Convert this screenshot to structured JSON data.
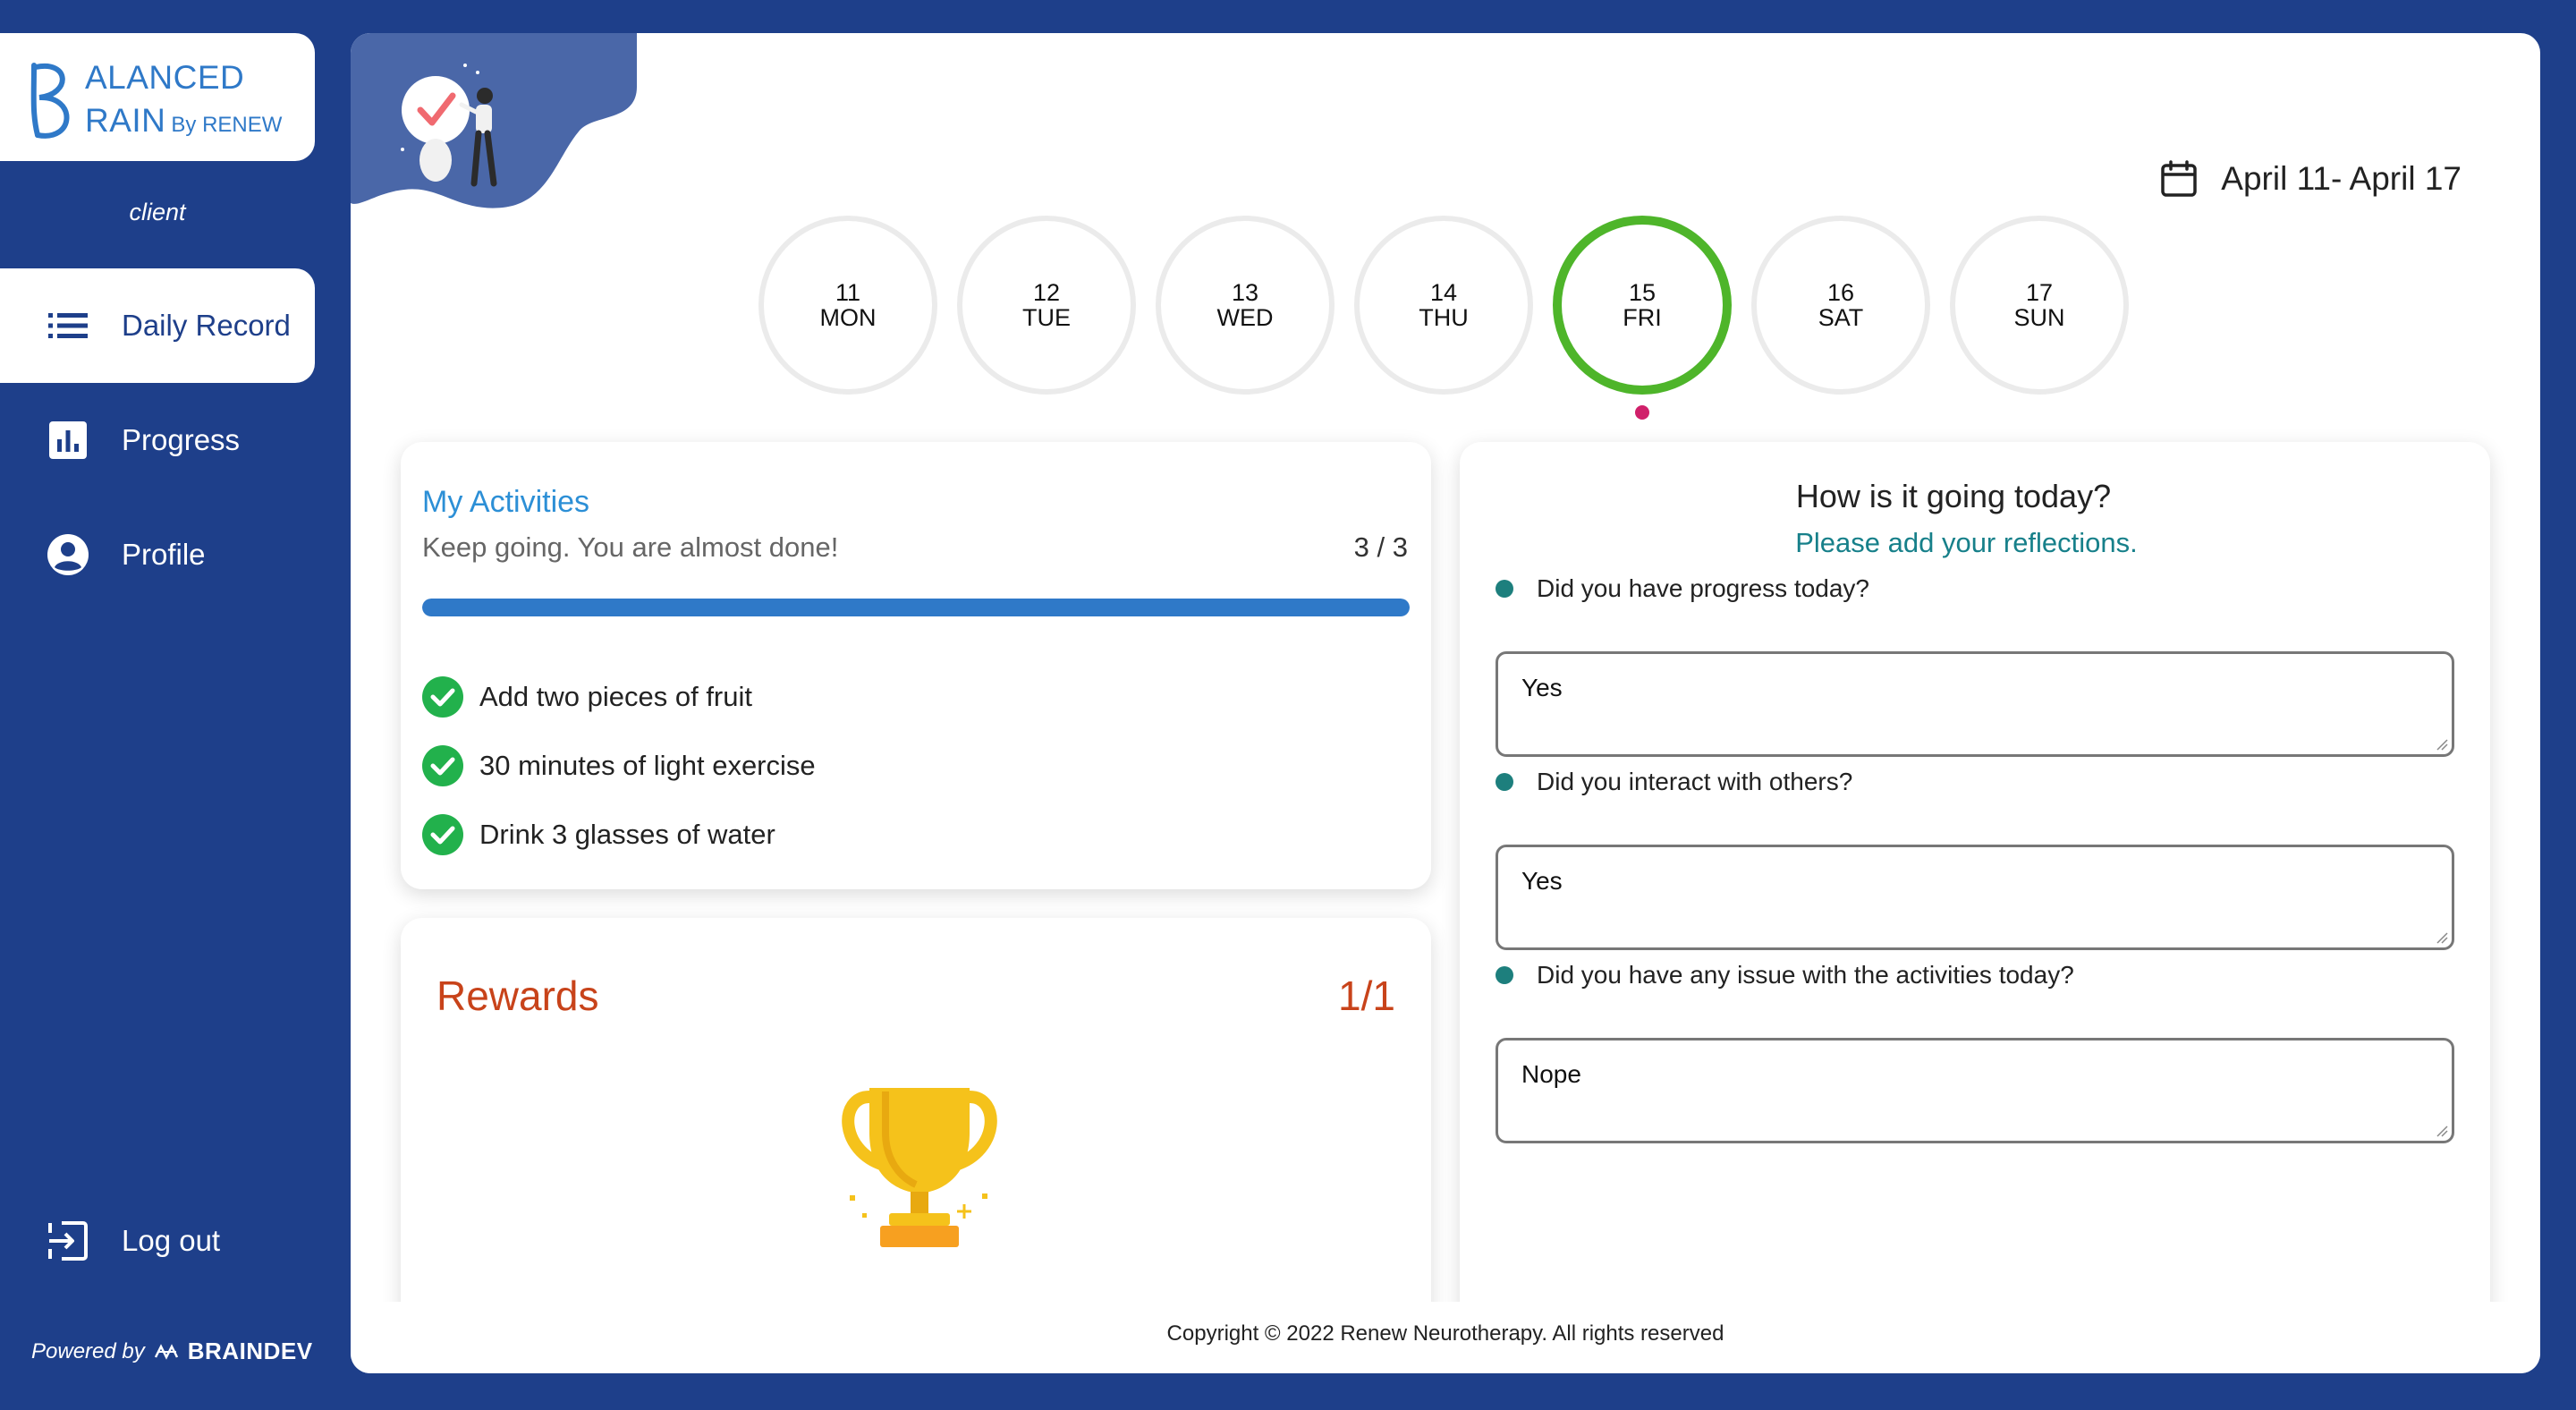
{
  "brand": {
    "logo_letter": "B",
    "line1": "ALANCED",
    "line2": "RAIN",
    "by": "By RENEW",
    "powered_prefix": "Powered by",
    "powered_brand": "BRAINDEV",
    "accent": "#2f79c8",
    "sidebar_bg": "#1e3f8a"
  },
  "user": {
    "role": "client"
  },
  "nav": {
    "items": [
      {
        "label": "Daily Record",
        "icon": "list-icon",
        "active": true
      },
      {
        "label": "Progress",
        "icon": "bar-chart-icon",
        "active": false
      },
      {
        "label": "Profile",
        "icon": "account-circle-icon",
        "active": false
      }
    ],
    "logout": {
      "label": "Log out",
      "icon": "logout-icon"
    }
  },
  "week": {
    "range": "April 11- April 17",
    "days": [
      {
        "num": "11",
        "name": "MON",
        "selected": false
      },
      {
        "num": "12",
        "name": "TUE",
        "selected": false
      },
      {
        "num": "13",
        "name": "WED",
        "selected": false
      },
      {
        "num": "14",
        "name": "THU",
        "selected": false
      },
      {
        "num": "15",
        "name": "FRI",
        "selected": true
      },
      {
        "num": "16",
        "name": "SAT",
        "selected": false
      },
      {
        "num": "17",
        "name": "SUN",
        "selected": false
      }
    ],
    "selected_color": "#4eb52a",
    "dot_color": "#d0206a"
  },
  "activities": {
    "title": "My Activities",
    "subtitle": "Keep going. You are almost done!",
    "count": "3 / 3",
    "progress": 1.0,
    "items": [
      {
        "label": "Add two pieces of fruit",
        "done": true
      },
      {
        "label": "30 minutes of light exercise",
        "done": true
      },
      {
        "label": "Drink 3 glasses of water",
        "done": true
      }
    ]
  },
  "rewards": {
    "title": "Rewards",
    "count": "1/1",
    "icon": "trophy-icon"
  },
  "reflections": {
    "title": "How is it going today?",
    "subtitle": "Please add your reflections.",
    "questions": [
      {
        "label": "Did you have progress today?",
        "answer": "Yes"
      },
      {
        "label": "Did you interact with others?",
        "answer": "Yes"
      },
      {
        "label": "Did you have any issue with the activities today?",
        "answer": "Nope"
      }
    ]
  },
  "footer": {
    "copyright": "Copyright © 2022 Renew Neurotherapy. All rights reserved"
  }
}
